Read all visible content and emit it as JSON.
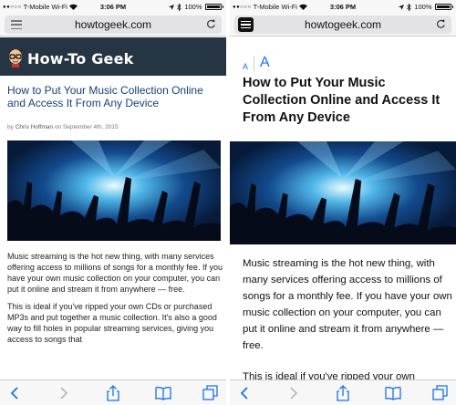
{
  "status": {
    "signal_dots": "●●○○○",
    "carrier": "T-Mobile Wi-Fi",
    "time": "3:06 PM",
    "battery": "100%"
  },
  "url": "howtogeek.com",
  "site": {
    "logo_text": "How-To Geek"
  },
  "article": {
    "title": "How to Put Your Music Collection Online and Access It From Any Device",
    "byline_prefix": "by",
    "author": "Chris Hoffman",
    "byline_date": "on September 4th, 2015",
    "p1": "Music streaming is the hot new thing, with many services offering access to millions of songs for a monthly fee. If you have your own music collection on your computer, you can put it online and stream it from anywhere — free.",
    "p2": "This is ideal if you've ripped your own CDs or purchased MP3s and put together a music collection. It's also a good way to fill holes in popular streaming services, giving you access to songs that",
    "p2_reader_fragment": "This is ideal if you've ripped your own"
  },
  "reader": {
    "font_small": "A",
    "font_large": "A"
  },
  "colors": {
    "header_bg": "#263544",
    "title_link": "#15407a",
    "ios_blue": "#1a73e8"
  },
  "icons": [
    "reader-icon",
    "reload-icon",
    "wifi-icon",
    "location-icon",
    "bluetooth-icon",
    "battery-icon",
    "back-icon",
    "forward-icon",
    "share-icon",
    "bookmarks-icon",
    "tabs-icon"
  ]
}
